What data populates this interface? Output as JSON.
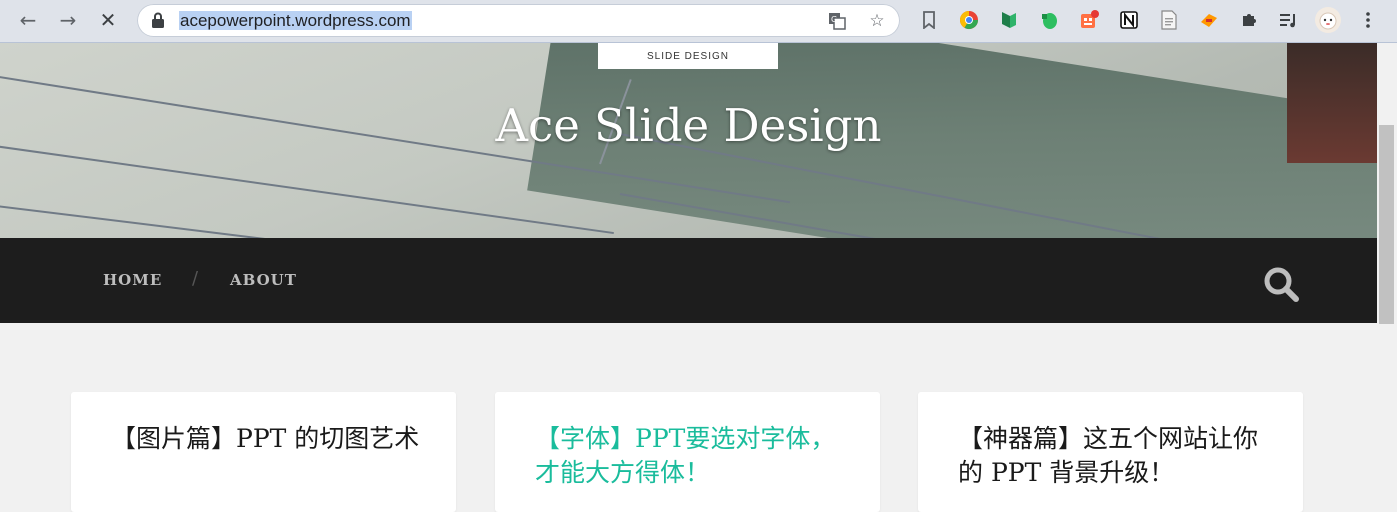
{
  "browser": {
    "url": "acepowerpoint.wordpress.com",
    "nav_back": "←",
    "nav_forward": "→",
    "nav_stop": "✕",
    "star": "☆",
    "extensions": [
      "bookmark-icon",
      "chrome-icon",
      "ext-green-icon",
      "evernote-icon",
      "ext-counter-icon",
      "notion-icon",
      "page-icon",
      "ext-orange-icon",
      "puzzle-icon",
      "media-icon",
      "profile-avatar",
      "menu-icon"
    ]
  },
  "site": {
    "logo_text": "SLIDE DESIGN",
    "title": "Ace Slide Design",
    "nav": [
      {
        "label": "HOME"
      },
      {
        "label": "ABOUT"
      }
    ],
    "nav_separator": "/"
  },
  "posts": [
    {
      "title": "【图片篇】PPT 的切图艺术",
      "highlight": false
    },
    {
      "title": "【字体】PPT要选对字体，才能大方得体！",
      "highlight": true
    },
    {
      "title": "【神器篇】这五个网站让你的 PPT 背景升级！",
      "highlight": false
    }
  ],
  "colors": {
    "accent": "#1abc9c",
    "navbar": "#1d1d1d",
    "page_bg": "#f1f1f1"
  }
}
